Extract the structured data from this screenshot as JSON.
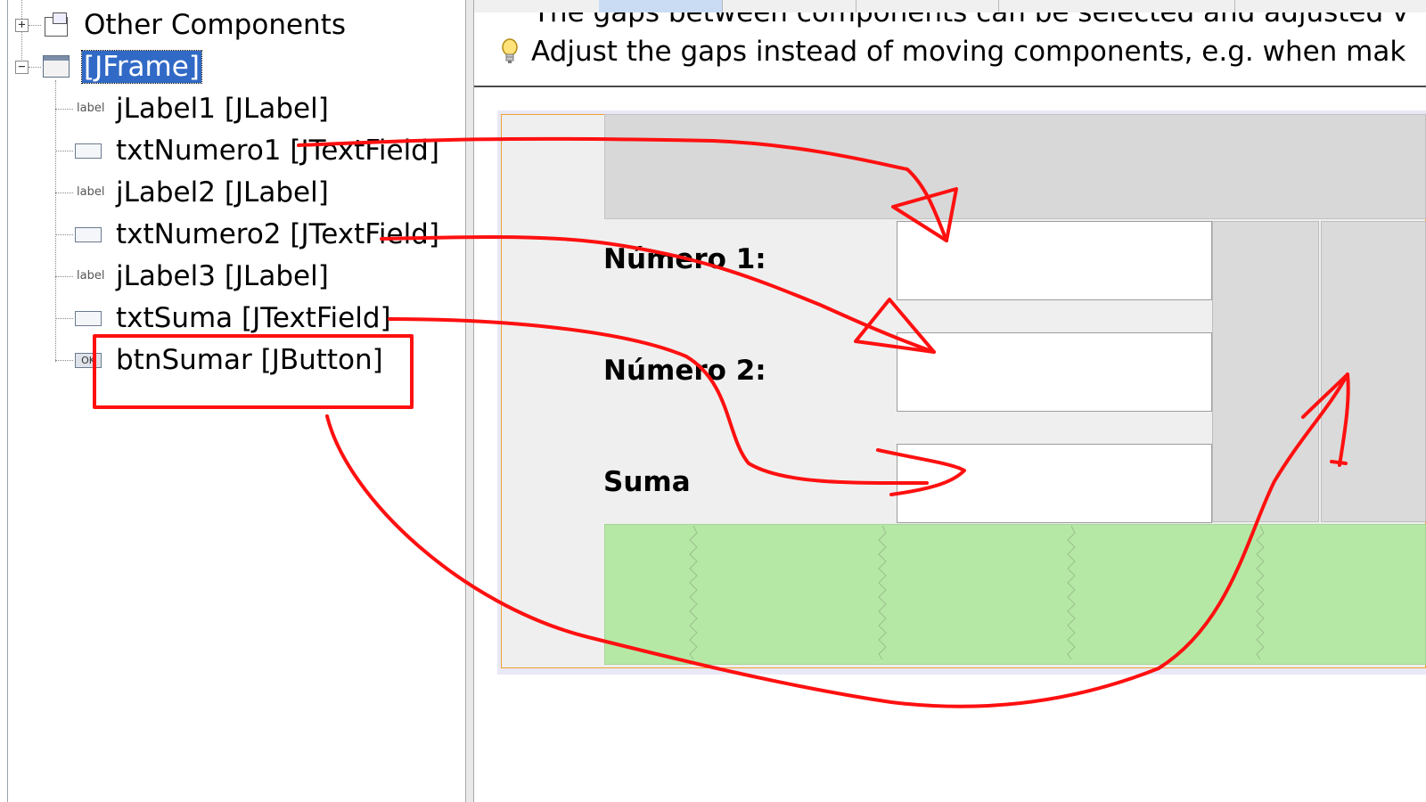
{
  "navigator": {
    "items": [
      {
        "label": "Other Components",
        "icon": "other-components-icon",
        "expander": "+"
      },
      {
        "label": "[JFrame]",
        "icon": "jframe-icon",
        "expander": "−",
        "selected": true
      },
      {
        "label": "jLabel1 [JLabel]",
        "icon": "jlabel-icon",
        "icon_text": "label"
      },
      {
        "label": "txtNumero1 [JTextField]",
        "icon": "jtextfield-icon"
      },
      {
        "label": "jLabel2 [JLabel]",
        "icon": "jlabel-icon",
        "icon_text": "label"
      },
      {
        "label": "txtNumero2 [JTextField]",
        "icon": "jtextfield-icon"
      },
      {
        "label": "jLabel3 [JLabel]",
        "icon": "jlabel-icon",
        "icon_text": "label"
      },
      {
        "label": "txtSuma [JTextField]",
        "icon": "jtextfield-icon"
      },
      {
        "label": "btnSumar [JButton]",
        "icon": "jbutton-icon",
        "icon_text": "OK"
      }
    ]
  },
  "hint": {
    "line1": "The gaps between components can be selected and adjusted v",
    "line2": "Adjust the gaps instead of moving components, e.g. when mak",
    "icon": "lightbulb-icon"
  },
  "form": {
    "label1": "Número 1:",
    "label2": "Número 2:",
    "label3": "Suma"
  },
  "colors": {
    "selection": "#3169c6",
    "annotation": "#ff0000",
    "button_area": "#b5e8a5",
    "frame_border": "#f0a030"
  }
}
